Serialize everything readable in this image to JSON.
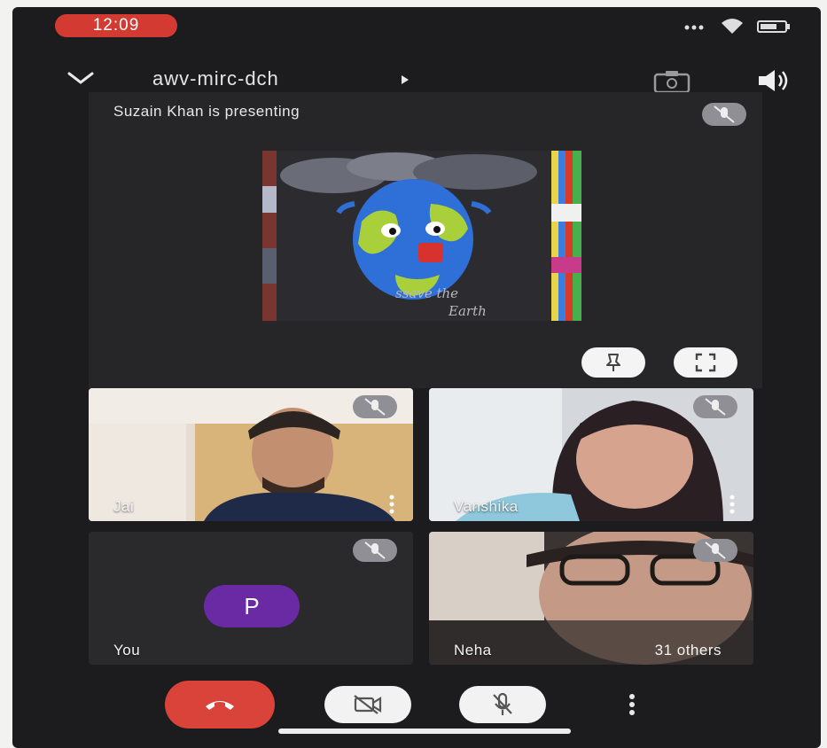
{
  "status_bar": {
    "time": "12:09"
  },
  "topbar": {
    "meeting_code": "awv-mirc-dch"
  },
  "presentation": {
    "presenter_text": "Suzain Khan is presenting"
  },
  "participants": [
    {
      "name": "Jai"
    },
    {
      "name": "Vanshika"
    },
    {
      "name": "You",
      "avatar_letter": "P"
    },
    {
      "name": "Neha",
      "others": "31 others"
    }
  ],
  "icons": {
    "collapse": "chevron-down-icon",
    "switch_camera": "switch-camera-icon",
    "speaker": "speaker-icon",
    "muted": "mic-off-icon",
    "pin": "pin-icon",
    "fullscreen": "fullscreen-icon",
    "end_call": "end-call-icon",
    "camera_off": "camera-off-icon",
    "mic_off": "mic-off-icon",
    "more": "more-vert-icon"
  },
  "colors": {
    "end_call": "#d94339",
    "time_pill": "#d33a32",
    "avatar": "#6a2aa3",
    "background": "#1c1c1e"
  }
}
